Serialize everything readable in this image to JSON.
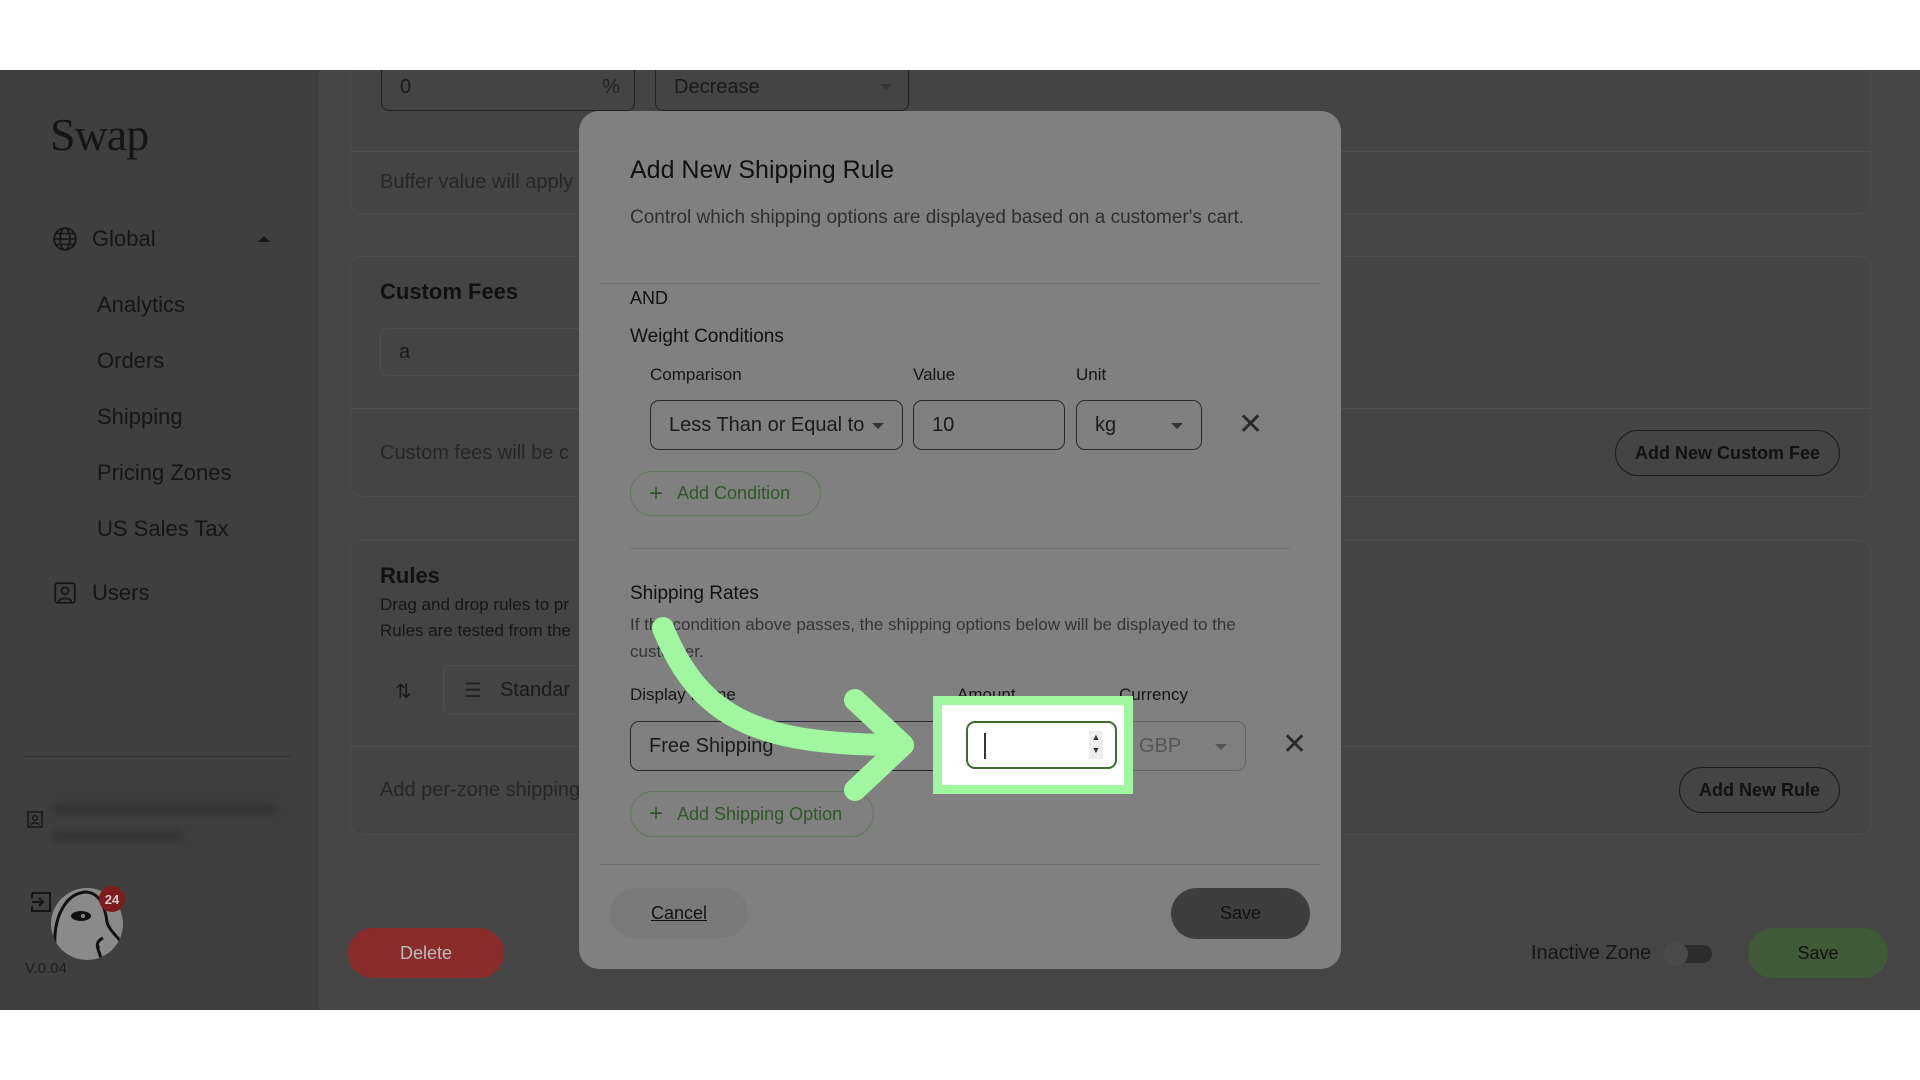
{
  "sidebar": {
    "logo": "Swap",
    "group": {
      "label": "Global",
      "icon": "globe-icon",
      "expanded": true
    },
    "items": [
      {
        "label": "Analytics"
      },
      {
        "label": "Orders"
      },
      {
        "label": "Shipping"
      },
      {
        "label": "Pricing Zones"
      },
      {
        "label": "US Sales Tax"
      }
    ],
    "users": {
      "label": "Users",
      "icon": "user-icon"
    },
    "notification_count": "24",
    "version": "V.0.04"
  },
  "main": {
    "buffer": {
      "value": "0",
      "unit": "%",
      "direction": "Decrease",
      "note": "Buffer value will apply"
    },
    "custom_fees": {
      "title": "Custom Fees",
      "input_value": "a",
      "note": "Custom fees will be c",
      "add_button": "Add New Custom Fee"
    },
    "rules": {
      "title": "Rules",
      "desc_line1": "Drag and drop rules to pr",
      "desc_line2": "Rules are tested from the",
      "rule_name": "Standar",
      "note": "Add per-zone shipping",
      "add_button": "Add New Rule"
    },
    "footer": {
      "delete": "Delete",
      "inactive_label": "Inactive Zone",
      "inactive_on": false,
      "save": "Save"
    }
  },
  "modal": {
    "title": "Add New Shipping Rule",
    "description": "Control which shipping options are displayed based on a customer's cart.",
    "and_label": "AND",
    "weight": {
      "title": "Weight Conditions",
      "labels": {
        "comparison": "Comparison",
        "value": "Value",
        "unit": "Unit"
      },
      "comparison": "Less Than or Equal to",
      "value": "10",
      "unit": "kg",
      "add_condition": "Add Condition"
    },
    "rates": {
      "title": "Shipping Rates",
      "description": "If the condition above passes, the shipping options below will be displayed to the customer.",
      "labels": {
        "display_name": "Display Name",
        "amount": "Amount",
        "currency": "Currency"
      },
      "display_name": "Free Shipping",
      "amount": "",
      "currency": "GBP",
      "add_option": "Add Shipping Option"
    },
    "cancel": "Cancel",
    "save": "Save"
  },
  "colors": {
    "highlight": "#a0f7a0",
    "accent_green": "#2c5a24",
    "delete_red": "#8a2c2c",
    "save_green": "#3f5a36"
  }
}
